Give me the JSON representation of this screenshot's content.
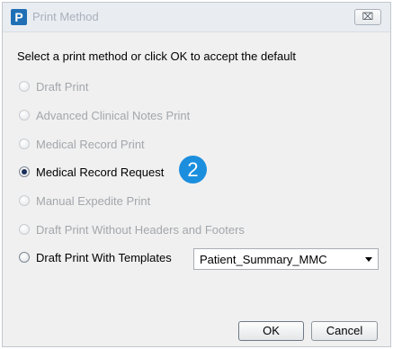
{
  "dialog": {
    "app_icon_letter": "P",
    "title": "Print Method",
    "close_symbol": "⌧"
  },
  "prompt": "Select a print method or click OK to accept the default",
  "options": [
    {
      "label": "Draft Print",
      "enabled": false,
      "selected": false
    },
    {
      "label": "Advanced Clinical Notes Print",
      "enabled": false,
      "selected": false
    },
    {
      "label": "Medical Record Print",
      "enabled": false,
      "selected": false
    },
    {
      "label": "Medical Record Request",
      "enabled": true,
      "selected": true
    },
    {
      "label": "Manual Expedite Print",
      "enabled": false,
      "selected": false
    },
    {
      "label": "Draft Print Without Headers and Footers",
      "enabled": false,
      "selected": false
    },
    {
      "label": "Draft Print With Templates",
      "enabled": true,
      "selected": false
    }
  ],
  "step_badge": "2",
  "template_select": {
    "value": "Patient_Summary_MMC"
  },
  "buttons": {
    "ok": "OK",
    "cancel": "Cancel"
  },
  "colors": {
    "badge": "#1c8ede",
    "logo": "#1f6fb5",
    "disabled_text": "#a3a7ab"
  }
}
